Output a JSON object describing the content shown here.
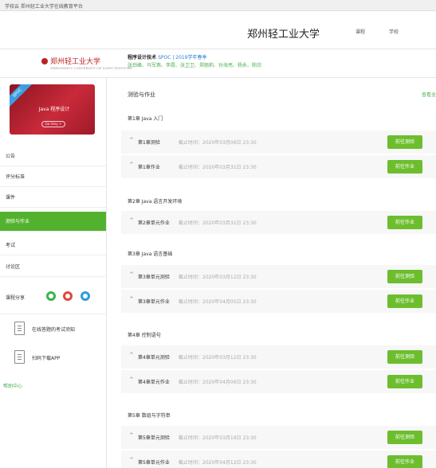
{
  "topbar": {
    "text": "学校云  郑州轻工业大学在线教育平台"
  },
  "header": {
    "school_name": "郑州轻工业大学",
    "link1": "课程",
    "link2": "学校"
  },
  "logo": {
    "text": "郑州轻工业大学",
    "sub": "ZHENGZHOU UNIVERSITY OF LIGHT INDUSTRY"
  },
  "course": {
    "title": "程序设计技术",
    "spoc": "SPOC | 2019学年春季",
    "teachers": "张劲峰、马军燕、李霞、张卫卫、郑丽莉、孙海亮、杨永、陈欣"
  },
  "cover": {
    "badge": "SPOC",
    "line1": "Java 程序设计",
    "button": "Go lrary >"
  },
  "sidebar": {
    "items": [
      {
        "label": "公告"
      },
      {
        "label": "评分标准"
      },
      {
        "label": "课件"
      },
      {
        "label": "测验与作业"
      },
      {
        "label": "考试"
      },
      {
        "label": "讨论区"
      }
    ],
    "score_label": "课程分享",
    "actions": [
      {
        "label": "在线答题的考试须知"
      },
      {
        "label": "扫码下载APP"
      }
    ],
    "help": "帮助中心"
  },
  "main": {
    "title": "测验与作业",
    "view_all": "查看全部",
    "chapters": [
      {
        "title": "第1章 Java 入门",
        "items": [
          {
            "name": "第1章测验",
            "deadline": "截止时间：2020年03月06日 23:30",
            "btn": "前往测验"
          },
          {
            "name": "第1章作业",
            "deadline": "截止时间：2020年03月31日 23:30",
            "btn": "前往作业"
          }
        ]
      },
      {
        "title": "第2章 Java 语言开发环境",
        "items": [
          {
            "name": "第2章单元作业",
            "deadline": "截止时间：2020年03月31日 23:30",
            "btn": "前往作业"
          }
        ]
      },
      {
        "title": "第3章 Java 语言基础",
        "items": [
          {
            "name": "第3章单元测验",
            "deadline": "截止时间：2020年03月12日 23:30",
            "btn": "前往测验"
          },
          {
            "name": "第3章单元作业",
            "deadline": "截止时间：2020年04月05日 23:30",
            "btn": "前往作业"
          }
        ]
      },
      {
        "title": "第4章 控制语句",
        "items": [
          {
            "name": "第4章单元测验",
            "deadline": "截止时间：2020年03月12日 23:30",
            "btn": "前往测验"
          },
          {
            "name": "第4章单元作业",
            "deadline": "截止时间：2020年04月06日 23:30",
            "btn": "前往作业"
          }
        ]
      },
      {
        "title": "第5章 数组与字符串",
        "items": [
          {
            "name": "第5章单元测验",
            "deadline": "截止时间：2020年03月19日 23:30",
            "btn": "前往测验"
          },
          {
            "name": "第5章单元作业",
            "deadline": "截止时间：2020年04月12日 23:30",
            "btn": "前往作业"
          }
        ]
      }
    ]
  },
  "colors": {
    "accent": "#53b22d",
    "button": "#6cbe2e",
    "share_green": "#3cb34a",
    "share_red": "#e0473c",
    "share_blue": "#2f9be0"
  }
}
